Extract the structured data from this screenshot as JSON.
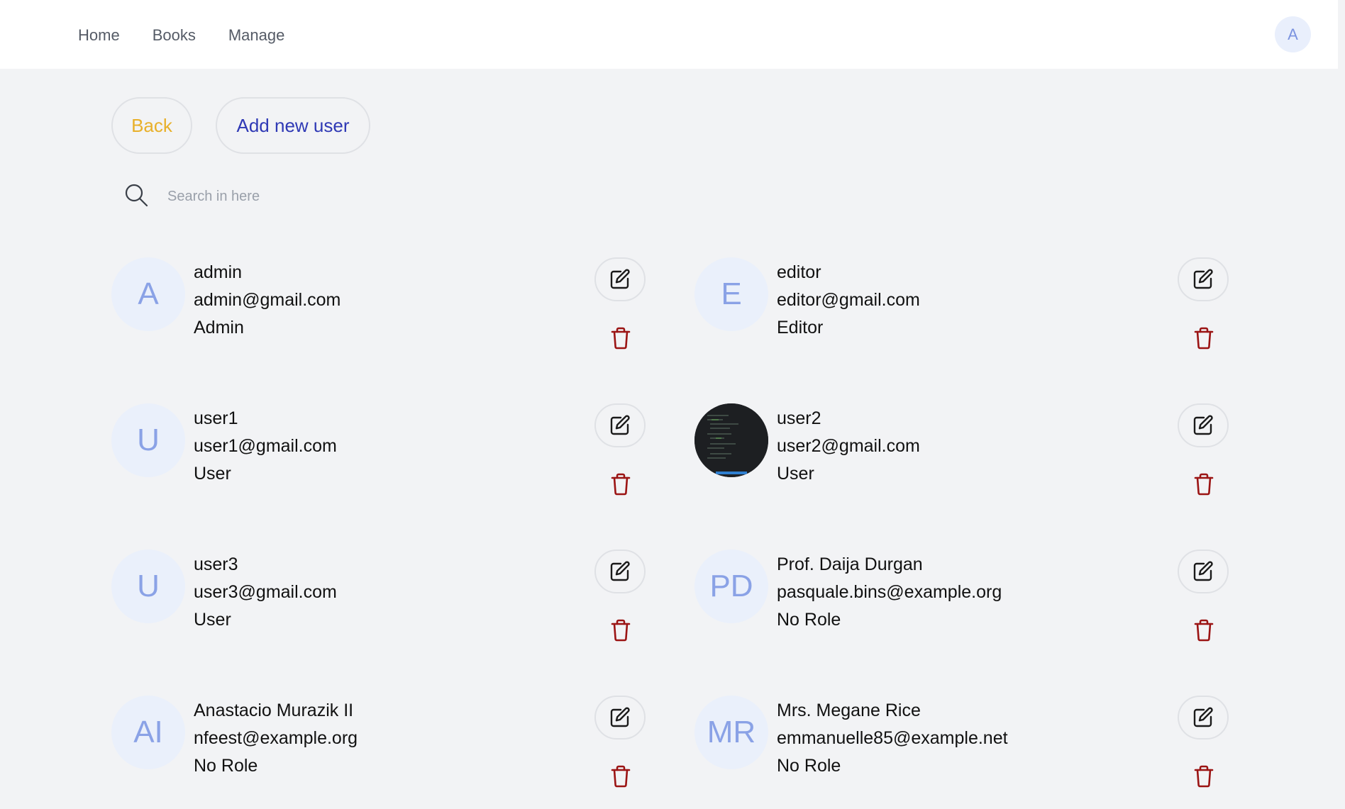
{
  "nav": {
    "links": [
      "Home",
      "Books",
      "Manage"
    ],
    "avatar_initial": "A"
  },
  "actions": {
    "back_label": "Back",
    "add_user_label": "Add new user"
  },
  "search": {
    "placeholder": "Search in here",
    "value": ""
  },
  "users": [
    {
      "initials": "A",
      "name": "admin",
      "email": "admin@gmail.com",
      "role": "Admin",
      "avatar": "initials"
    },
    {
      "initials": "E",
      "name": "editor",
      "email": "editor@gmail.com",
      "role": "Editor",
      "avatar": "initials"
    },
    {
      "initials": "U",
      "name": "user1",
      "email": "user1@gmail.com",
      "role": "User",
      "avatar": "initials"
    },
    {
      "initials": "",
      "name": "user2",
      "email": "user2@gmail.com",
      "role": "User",
      "avatar": "photo"
    },
    {
      "initials": "U",
      "name": "user3",
      "email": "user3@gmail.com",
      "role": "User",
      "avatar": "initials"
    },
    {
      "initials": "PD",
      "name": "Prof. Daija Durgan",
      "email": "pasquale.bins@example.org",
      "role": "No Role",
      "avatar": "initials"
    },
    {
      "initials": "AI",
      "name": "Anastacio Murazik II",
      "email": "nfeest@example.org",
      "role": "No Role",
      "avatar": "initials"
    },
    {
      "initials": "MR",
      "name": "Mrs. Megane Rice",
      "email": "emmanuelle85@example.net",
      "role": "No Role",
      "avatar": "initials"
    }
  ],
  "icons": {
    "search": "search-icon",
    "edit": "edit-icon",
    "delete": "trash-icon"
  },
  "colors": {
    "back": "#e8b02a",
    "add": "#2f39b5",
    "delete": "#9b1414",
    "avatar_text": "#8aa2e6"
  }
}
